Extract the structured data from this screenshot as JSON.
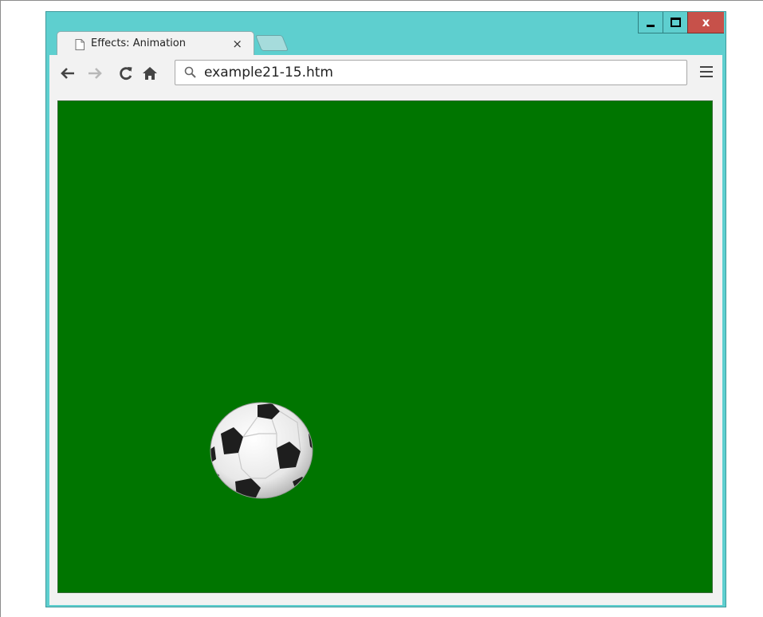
{
  "window": {
    "tab_title": "Effects: Animation",
    "tab_close_glyph": "×",
    "close_glyph": "x"
  },
  "toolbar": {
    "address": "example21-15.htm",
    "icons": [
      "back-icon",
      "forward-icon",
      "reload-icon",
      "home-icon",
      "search-icon",
      "menu-icon"
    ]
  },
  "colors": {
    "window_frame": "#5ecfcf",
    "close_button": "#c7514a",
    "canvas_background": "#007500"
  }
}
